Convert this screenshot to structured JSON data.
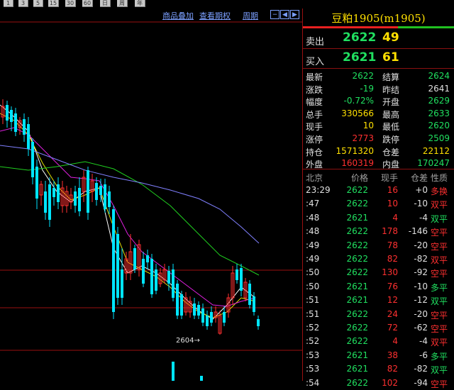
{
  "toolbar": {
    "buttons": [
      "1",
      "3",
      "5",
      "15",
      "30",
      "60",
      "日",
      "周",
      "年"
    ]
  },
  "chart": {
    "links": {
      "overlay": "商品叠加",
      "options": "查看期权",
      "period": "周期"
    },
    "low_annotation": "2604→",
    "colors": {
      "up": "#ff3030",
      "down": "#00e5ff",
      "ma1": "#ffffff",
      "ma2": "#e0e000",
      "ma3": "#e020e0",
      "ma4": "#20d020",
      "ma5": "#8080ff",
      "grid": "#9a1010"
    }
  },
  "panel": {
    "title": "豆粕1905(m1905)",
    "sell": {
      "label": "卖出",
      "price": "2622",
      "vol": "49"
    },
    "buy": {
      "label": "买入",
      "price": "2621",
      "vol": "61"
    },
    "stats": [
      {
        "k1": "最新",
        "v1": "2622",
        "c1": "green",
        "k2": "结算",
        "v2": "2624",
        "c2": "green"
      },
      {
        "k1": "涨跌",
        "v1": "-19",
        "c1": "green",
        "k2": "昨结",
        "v2": "2641",
        "c2": "white"
      },
      {
        "k1": "幅度",
        "v1": "-0.72%",
        "c1": "green",
        "k2": "开盘",
        "v2": "2629",
        "c2": "green"
      },
      {
        "k1": "总手",
        "v1": "330566",
        "c1": "yellow",
        "k2": "最高",
        "v2": "2633",
        "c2": "green"
      },
      {
        "k1": "现手",
        "v1": "10",
        "c1": "yellow",
        "k2": "最低",
        "v2": "2620",
        "c2": "green"
      },
      {
        "k1": "涨停",
        "v1": "2773",
        "c1": "red",
        "k2": "跌停",
        "v2": "2509",
        "c2": "green"
      },
      {
        "k1": "持仓",
        "v1": "1571320",
        "c1": "yellow",
        "k2": "仓差",
        "v2": "22112",
        "c2": "yellow"
      },
      {
        "k1": "外盘",
        "v1": "160319",
        "c1": "red",
        "k2": "内盘",
        "v2": "170247",
        "c2": "green"
      }
    ],
    "tick_header": [
      "北京",
      "价格",
      "现手",
      "仓差",
      "性质"
    ],
    "ticks": [
      {
        "time": "23:29",
        "price": "2622",
        "vol": "16",
        "diff": "+0",
        "nature": "多换",
        "nc": "red"
      },
      {
        "time": ":47",
        "price": "2622",
        "vol": "10",
        "diff": "-10",
        "nature": "双平",
        "nc": "red"
      },
      {
        "time": ":48",
        "price": "2621",
        "vol": "4",
        "diff": "-4",
        "nature": "双平",
        "nc": "green"
      },
      {
        "time": ":48",
        "price": "2622",
        "vol": "178",
        "diff": "-146",
        "nature": "空平",
        "nc": "red"
      },
      {
        "time": ":49",
        "price": "2622",
        "vol": "78",
        "diff": "-20",
        "nature": "空平",
        "nc": "red"
      },
      {
        "time": ":49",
        "price": "2622",
        "vol": "82",
        "diff": "-82",
        "nature": "双平",
        "nc": "red"
      },
      {
        "time": ":50",
        "price": "2622",
        "vol": "130",
        "diff": "-92",
        "nature": "空平",
        "nc": "red"
      },
      {
        "time": ":50",
        "price": "2621",
        "vol": "76",
        "diff": "-10",
        "nature": "多平",
        "nc": "green"
      },
      {
        "time": ":51",
        "price": "2621",
        "vol": "12",
        "diff": "-12",
        "nature": "双平",
        "nc": "green"
      },
      {
        "time": ":51",
        "price": "2622",
        "vol": "24",
        "diff": "-20",
        "nature": "空平",
        "nc": "red"
      },
      {
        "time": ":52",
        "price": "2622",
        "vol": "72",
        "diff": "-62",
        "nature": "空平",
        "nc": "red"
      },
      {
        "time": ":52",
        "price": "2622",
        "vol": "4",
        "diff": "-4",
        "nature": "双平",
        "nc": "red"
      },
      {
        "time": ":53",
        "price": "2621",
        "vol": "38",
        "diff": "-6",
        "nature": "多平",
        "nc": "green"
      },
      {
        "time": ":53",
        "price": "2621",
        "vol": "82",
        "diff": "-82",
        "nature": "双平",
        "nc": "green"
      },
      {
        "time": ":54",
        "price": "2622",
        "vol": "102",
        "diff": "-94",
        "nature": "空平",
        "nc": "red"
      }
    ]
  }
}
